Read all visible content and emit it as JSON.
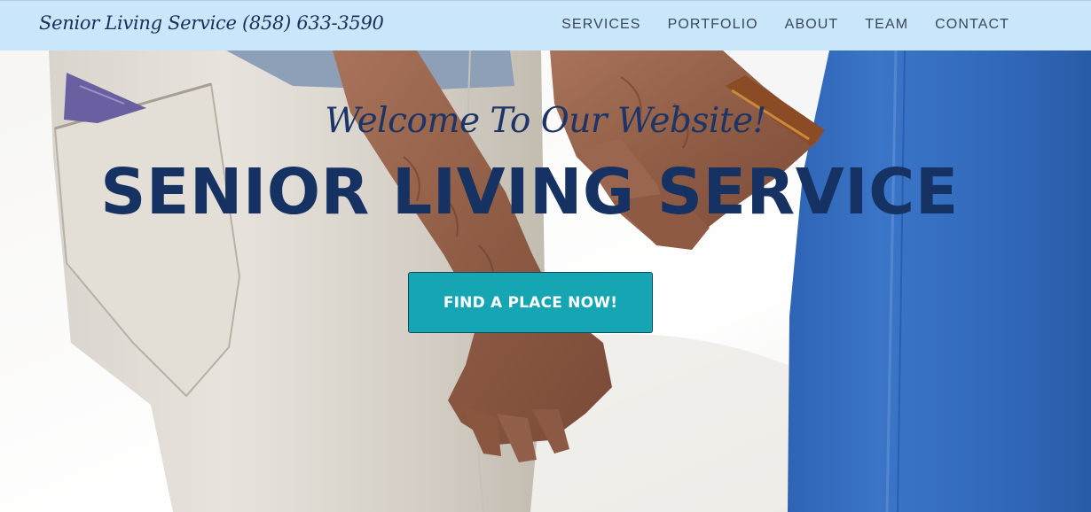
{
  "header": {
    "brand": "Senior Living Service (858) 633-3590",
    "nav": [
      {
        "label": "SERVICES"
      },
      {
        "label": "PORTFOLIO"
      },
      {
        "label": "ABOUT"
      },
      {
        "label": "TEAM"
      },
      {
        "label": "CONTACT"
      }
    ]
  },
  "hero": {
    "welcome": "Welcome To Our Website!",
    "headline": "SENIOR LIVING SERVICE",
    "cta_label": "FIND A PLACE NOW!"
  },
  "colors": {
    "navbar_bg": "#c9e6fa",
    "headline": "#163263",
    "cta_bg": "#16a6b3"
  }
}
